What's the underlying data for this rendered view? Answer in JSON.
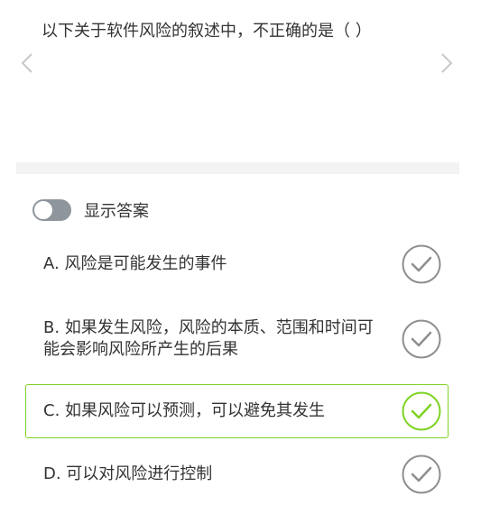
{
  "question": {
    "text": "以下关于软件风险的叙述中，不正确的是（ ）"
  },
  "nav": {
    "prev_icon": "chevron-left-icon",
    "next_icon": "chevron-right-icon"
  },
  "answer_toggle": {
    "label": "显示答案",
    "enabled": false
  },
  "options": [
    {
      "label": "A. 风险是可能发生的事件",
      "selected": false
    },
    {
      "label": "B. 如果发生风险，风险的本质、范围和时间可能会影响风险所产生的后果",
      "selected": false
    },
    {
      "label": "C. 如果风险可以预测，可以避免其发生",
      "selected": true
    },
    {
      "label": "D. 可以对风险进行控制",
      "selected": false
    }
  ],
  "colors": {
    "selected_accent": "#7ed321",
    "unselected_icon": "#8e8e8e",
    "toggle_off": "#8e959c",
    "nav_arrow": "#c8c8c8",
    "divider": "#f3f3f3"
  }
}
